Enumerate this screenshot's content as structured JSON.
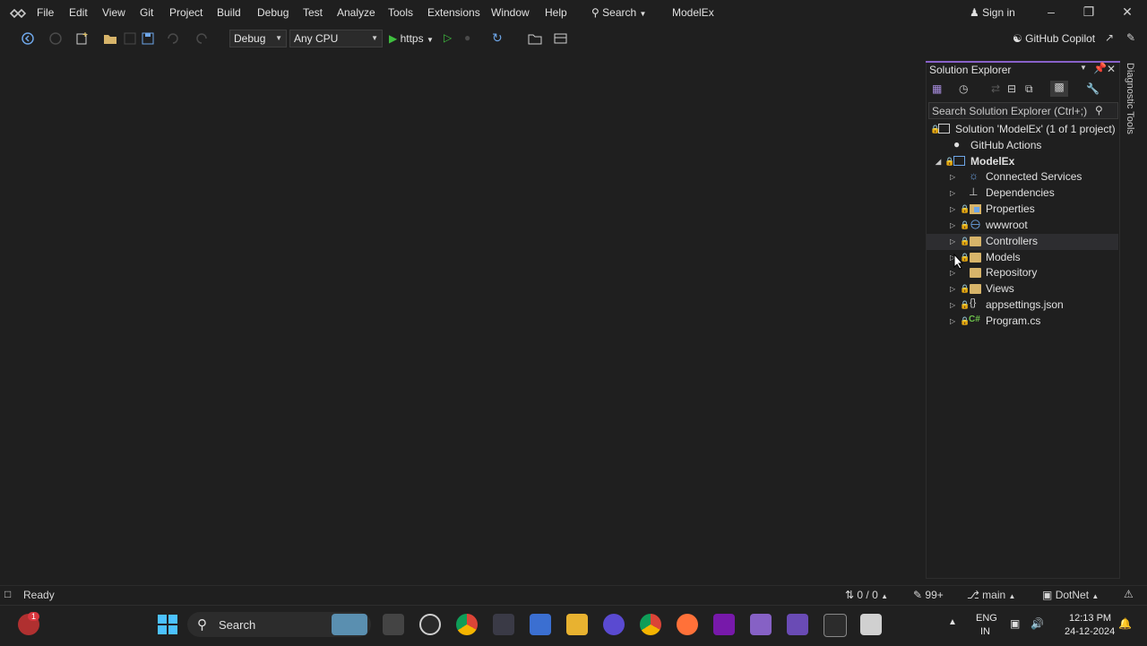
{
  "menu": {
    "items": [
      "File",
      "Edit",
      "View",
      "Git",
      "Project",
      "Build",
      "Debug",
      "Test",
      "Analyze",
      "Tools",
      "Extensions",
      "Window",
      "Help"
    ],
    "search_label": "Search",
    "app_title": "ModelEx",
    "sign_in": "Sign in"
  },
  "toolbar": {
    "config": "Debug",
    "platform": "Any CPU",
    "run_label": "https",
    "copilot": "GitHub Copilot"
  },
  "solution_explorer": {
    "title": "Solution Explorer",
    "search_placeholder": "Search Solution Explorer (Ctrl+;)",
    "solution": "Solution 'ModelEx' (1 of 1 project)",
    "github_actions": "GitHub Actions",
    "project": "ModelEx",
    "items": [
      {
        "label": "Connected Services",
        "icon": "connected-services-icon"
      },
      {
        "label": "Dependencies",
        "icon": "dependencies-icon"
      },
      {
        "label": "Properties",
        "icon": "properties-icon"
      },
      {
        "label": "wwwroot",
        "icon": "globe-icon"
      },
      {
        "label": "Controllers",
        "icon": "folder-icon"
      },
      {
        "label": "Models",
        "icon": "folder-icon"
      },
      {
        "label": "Repository",
        "icon": "folder-icon"
      },
      {
        "label": "Views",
        "icon": "folder-icon"
      },
      {
        "label": "appsettings.json",
        "icon": "json-file-icon"
      },
      {
        "label": "Program.cs",
        "icon": "csharp-file-icon"
      }
    ]
  },
  "side_tab": "Diagnostic Tools",
  "status": {
    "ready": "Ready",
    "sync": "0 / 0",
    "pending": "99+",
    "branch": "main",
    "repo": "DotNet"
  },
  "taskbar": {
    "search": "Search",
    "lang": "ENG",
    "region": "IN",
    "time": "12:13 PM",
    "date": "24-12-2024",
    "notification_badge": "1"
  },
  "colors": {
    "accent": "#8861c9",
    "background": "#1f1f1f",
    "folder": "#d7b46a",
    "run_green": "#3fbf3f"
  }
}
